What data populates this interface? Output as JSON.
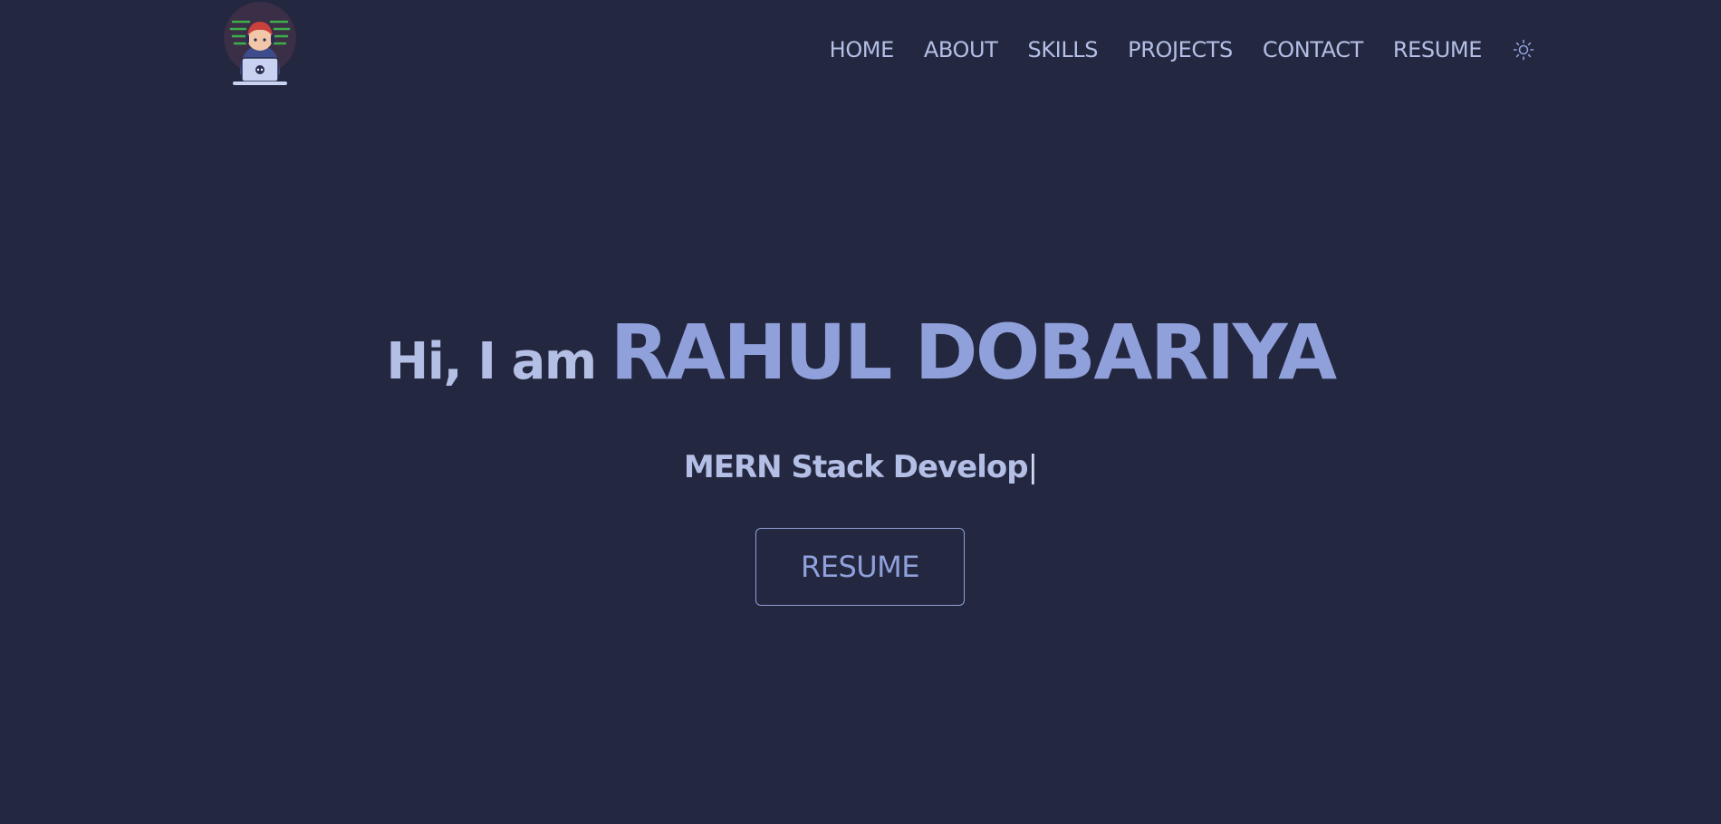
{
  "navbar": {
    "logo_icon": "developer-avatar-logo",
    "links": [
      {
        "label": "HOME"
      },
      {
        "label": "ABOUT"
      },
      {
        "label": "SKILLS"
      },
      {
        "label": "PROJECTS"
      },
      {
        "label": "CONTACT"
      },
      {
        "label": "RESUME"
      }
    ],
    "theme_toggle_icon": "sun-icon"
  },
  "hero": {
    "greeting_prefix": "Hi, I am",
    "name": "RAHUL DOBARIYA",
    "role_text": "MERN Stack Develop",
    "cursor": "|",
    "button_label": "RESUME"
  },
  "colors": {
    "background": "#23273f",
    "text": "#b4bfe6",
    "accent": "#8fa0db"
  }
}
